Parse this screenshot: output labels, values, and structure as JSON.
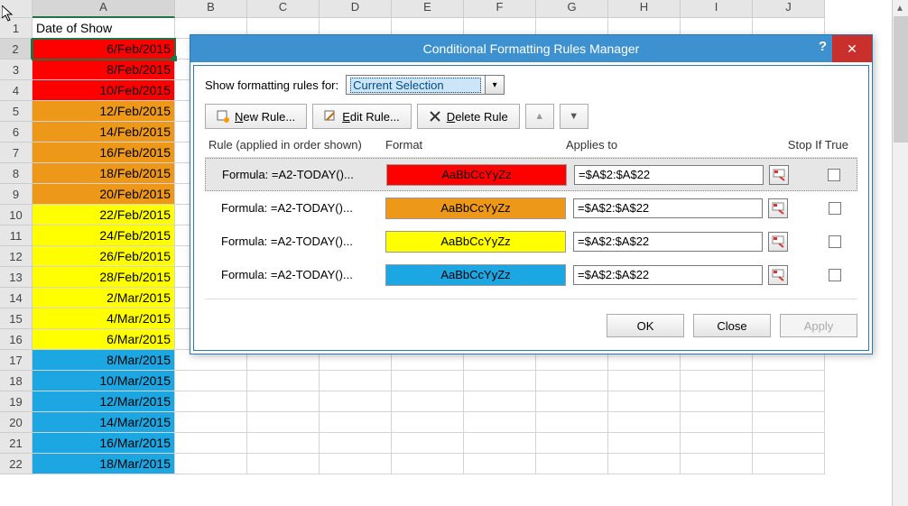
{
  "columns": [
    "A",
    "B",
    "C",
    "D",
    "E",
    "F",
    "G",
    "H",
    "I",
    "J"
  ],
  "header_cell": "Date of Show",
  "rows": [
    {
      "n": 1,
      "val": "Date of Show",
      "bg": "",
      "left": true
    },
    {
      "n": 2,
      "val": "6/Feb/2015",
      "bg": "bg-red",
      "sel": true
    },
    {
      "n": 3,
      "val": "8/Feb/2015",
      "bg": "bg-red"
    },
    {
      "n": 4,
      "val": "10/Feb/2015",
      "bg": "bg-red"
    },
    {
      "n": 5,
      "val": "12/Feb/2015",
      "bg": "bg-orange"
    },
    {
      "n": 6,
      "val": "14/Feb/2015",
      "bg": "bg-orange"
    },
    {
      "n": 7,
      "val": "16/Feb/2015",
      "bg": "bg-orange"
    },
    {
      "n": 8,
      "val": "18/Feb/2015",
      "bg": "bg-orange"
    },
    {
      "n": 9,
      "val": "20/Feb/2015",
      "bg": "bg-orange"
    },
    {
      "n": 10,
      "val": "22/Feb/2015",
      "bg": "bg-yellow"
    },
    {
      "n": 11,
      "val": "24/Feb/2015",
      "bg": "bg-yellow"
    },
    {
      "n": 12,
      "val": "26/Feb/2015",
      "bg": "bg-yellow"
    },
    {
      "n": 13,
      "val": "28/Feb/2015",
      "bg": "bg-yellow"
    },
    {
      "n": 14,
      "val": "2/Mar/2015",
      "bg": "bg-yellow"
    },
    {
      "n": 15,
      "val": "4/Mar/2015",
      "bg": "bg-yellow"
    },
    {
      "n": 16,
      "val": "6/Mar/2015",
      "bg": "bg-yellow"
    },
    {
      "n": 17,
      "val": "8/Mar/2015",
      "bg": "bg-blue"
    },
    {
      "n": 18,
      "val": "10/Mar/2015",
      "bg": "bg-blue"
    },
    {
      "n": 19,
      "val": "12/Mar/2015",
      "bg": "bg-blue"
    },
    {
      "n": 20,
      "val": "14/Mar/2015",
      "bg": "bg-blue"
    },
    {
      "n": 21,
      "val": "16/Mar/2015",
      "bg": "bg-blue"
    },
    {
      "n": 22,
      "val": "18/Mar/2015",
      "bg": "bg-blue"
    }
  ],
  "dialog": {
    "title": "Conditional Formatting Rules Manager",
    "show_for_label": "Show formatting rules for:",
    "show_for_value": "Current Selection",
    "buttons": {
      "new": "New Rule...",
      "edit": "Edit Rule...",
      "delete": "Delete Rule",
      "ok": "OK",
      "close": "Close",
      "apply": "Apply"
    },
    "headers": {
      "rule": "Rule (applied in order shown)",
      "format": "Format",
      "applies": "Applies to",
      "stop": "Stop If True"
    },
    "format_sample": "AaBbCcYyZz",
    "rules": [
      {
        "formula": "Formula: =A2-TODAY()...",
        "bg": "#ff0000",
        "fg": "#000",
        "applies": "=$A$2:$A$22",
        "sel": true
      },
      {
        "formula": "Formula: =A2-TODAY()...",
        "bg": "#ed9819",
        "fg": "#000",
        "applies": "=$A$2:$A$22"
      },
      {
        "formula": "Formula: =A2-TODAY()...",
        "bg": "#ffff00",
        "fg": "#000",
        "applies": "=$A$2:$A$22"
      },
      {
        "formula": "Formula: =A2-TODAY()...",
        "bg": "#1ca7e2",
        "fg": "#000",
        "applies": "=$A$2:$A$22"
      }
    ]
  }
}
